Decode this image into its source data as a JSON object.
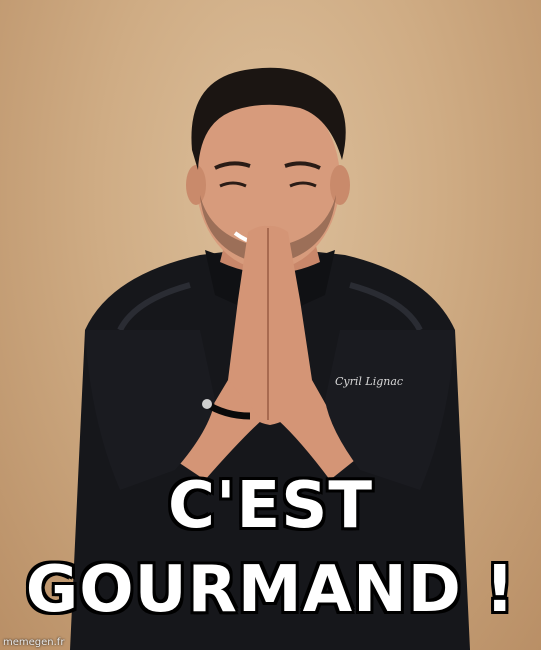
{
  "meme": {
    "caption_line1": "C'EST",
    "caption_line2": "GOURMAND !",
    "watermark": "memegen.fr",
    "jacket_embroidery": "Cyril Lignac"
  },
  "colors": {
    "background": "#cfac84",
    "jacket": "#16171b",
    "skin": "#d79b7c",
    "hair": "#1b1512",
    "caption_text": "#ffffff",
    "caption_stroke": "#000000"
  }
}
